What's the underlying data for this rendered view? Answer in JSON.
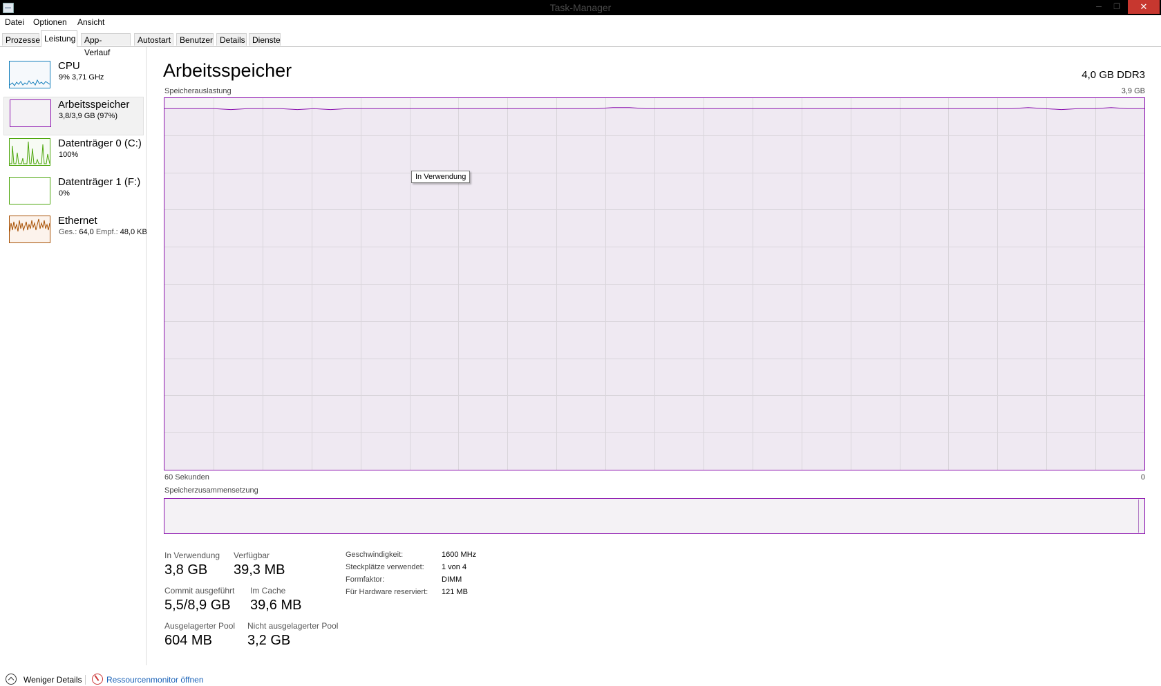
{
  "window": {
    "title": "Task-Manager",
    "minimize_glyph": "─",
    "maximize_glyph": "❐",
    "close_glyph": "✕"
  },
  "menu": [
    "Datei",
    "Optionen",
    "Ansicht"
  ],
  "tabs": [
    "Prozesse",
    "Leistung",
    "App-Verlauf",
    "Autostart",
    "Benutzer",
    "Details",
    "Dienste"
  ],
  "active_tab": "Leistung",
  "sidebar": {
    "items": [
      {
        "name": "CPU",
        "detail": "9%  3,71 GHz",
        "color": "#117dbb",
        "selected": false
      },
      {
        "name": "Arbeitsspeicher",
        "detail": "3,8/3,9 GB (97%)",
        "color": "#8b12ae",
        "selected": true
      },
      {
        "name": "Datenträger 0 (C:)",
        "detail": "100%",
        "color": "#4da60c",
        "selected": false
      },
      {
        "name": "Datenträger 1 (F:)",
        "detail": "0%",
        "color": "#4da60c",
        "selected": false
      },
      {
        "name": "Ethernet",
        "detail_label_send": "Ges.:",
        "detail_send": "64,0",
        "detail_label_recv": "Empf.:",
        "detail_recv": "48,0 KB",
        "color": "#a74f01",
        "selected": false
      }
    ]
  },
  "main": {
    "title": "Arbeitsspeicher",
    "spec": "4,0 GB DDR3",
    "graph_label": "Speicherauslastung",
    "graph_max": "3,9 GB",
    "graph_x_left": "60 Sekunden",
    "graph_x_right": "0",
    "tooltip": "In Verwendung",
    "composition_label": "Speicherzusammensetzung",
    "accent_color": "#8b12ae"
  },
  "chart_data": {
    "type": "line",
    "title": "Speicherauslastung",
    "xlabel": "60 Sekunden",
    "ylim": [
      0,
      3.9
    ],
    "y_unit": "GB",
    "series": [
      {
        "name": "In Verwendung",
        "values": [
          3.79,
          3.79,
          3.79,
          3.79,
          3.78,
          3.79,
          3.79,
          3.79,
          3.78,
          3.79,
          3.78,
          3.79,
          3.79,
          3.79,
          3.79,
          3.79,
          3.79,
          3.79,
          3.79,
          3.79,
          3.79,
          3.79,
          3.79,
          3.79,
          3.79,
          3.79,
          3.79,
          3.8,
          3.8,
          3.79,
          3.79,
          3.79,
          3.79,
          3.79,
          3.79,
          3.79,
          3.79,
          3.79,
          3.79,
          3.79,
          3.79,
          3.79,
          3.79,
          3.79,
          3.79,
          3.79,
          3.79,
          3.79,
          3.79,
          3.79,
          3.79,
          3.79,
          3.8,
          3.79,
          3.78,
          3.79,
          3.79,
          3.8,
          3.79,
          3.79
        ]
      }
    ]
  },
  "stats": [
    {
      "label": "In Verwendung",
      "value": "3,8 GB"
    },
    {
      "label": "Verfügbar",
      "value": "39,3 MB"
    },
    {
      "label": "Commit ausgeführt",
      "value": "5,5/8,9 GB"
    },
    {
      "label": "Im Cache",
      "value": "39,6 MB"
    },
    {
      "label": "Ausgelagerter Pool",
      "value": "604 MB"
    },
    {
      "label": "Nicht ausgelagerter Pool",
      "value": "3,2 GB"
    }
  ],
  "properties": [
    {
      "key": "Geschwindigkeit:",
      "value": "1600 MHz"
    },
    {
      "key": "Steckplätze verwendet:",
      "value": "1 von 4"
    },
    {
      "key": "Formfaktor:",
      "value": "DIMM"
    },
    {
      "key": "Für Hardware reserviert:",
      "value": "121 MB"
    }
  ],
  "footer": {
    "fewer_details": "Weniger Details",
    "resource_monitor": "Ressourcenmonitor öffnen"
  }
}
